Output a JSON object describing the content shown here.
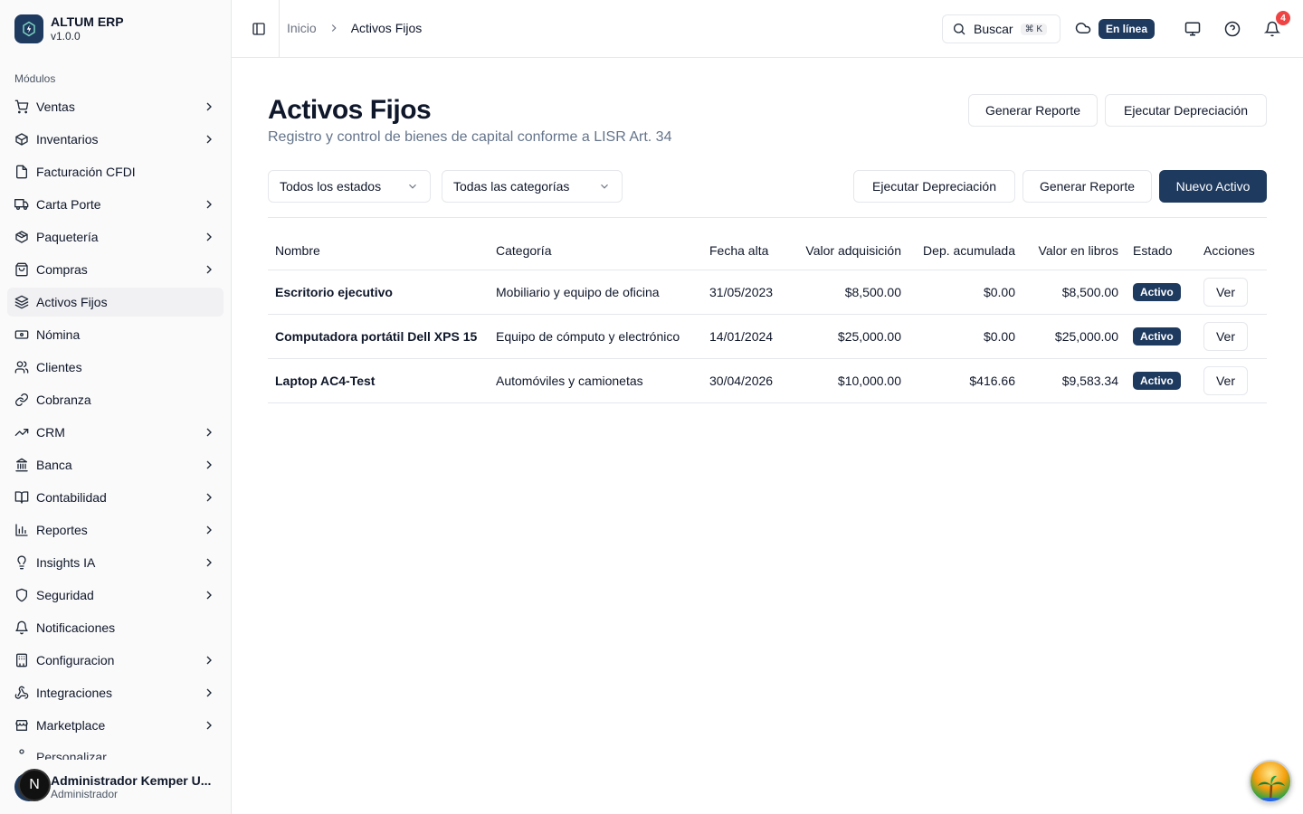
{
  "brand": {
    "name": "ALTUM ERP",
    "version": "v1.0.0"
  },
  "sidebar": {
    "section_label": "Módulos",
    "items": [
      {
        "label": "Ventas",
        "icon": "cart-icon",
        "chevron": true
      },
      {
        "label": "Inventarios",
        "icon": "package-icon",
        "chevron": true
      },
      {
        "label": "Facturación CFDI",
        "icon": "file-icon",
        "chevron": false
      },
      {
        "label": "Carta Porte",
        "icon": "truck-icon",
        "chevron": true
      },
      {
        "label": "Paquetería",
        "icon": "box-icon",
        "chevron": true
      },
      {
        "label": "Compras",
        "icon": "shopping-bag-icon",
        "chevron": true
      },
      {
        "label": "Activos Fijos",
        "icon": "layers-icon",
        "chevron": false,
        "active": true
      },
      {
        "label": "Nómina",
        "icon": "banknote-icon",
        "chevron": false
      },
      {
        "label": "Clientes",
        "icon": "users-icon",
        "chevron": false
      },
      {
        "label": "Cobranza",
        "icon": "link-icon",
        "chevron": false
      },
      {
        "label": "CRM",
        "icon": "trending-up-icon",
        "chevron": true
      },
      {
        "label": "Banca",
        "icon": "bank-icon",
        "chevron": true
      },
      {
        "label": "Contabilidad",
        "icon": "book-icon",
        "chevron": true
      },
      {
        "label": "Reportes",
        "icon": "bar-chart-icon",
        "chevron": true
      },
      {
        "label": "Insights IA",
        "icon": "lightbulb-icon",
        "chevron": true
      },
      {
        "label": "Seguridad",
        "icon": "shield-icon",
        "chevron": true
      },
      {
        "label": "Notificaciones",
        "icon": "bell-icon",
        "chevron": false
      },
      {
        "label": "Configuracion",
        "icon": "building-icon",
        "chevron": true
      },
      {
        "label": "Integraciones",
        "icon": "webhook-icon",
        "chevron": true
      },
      {
        "label": "Marketplace",
        "icon": "store-icon",
        "chevron": true
      }
    ],
    "partial_item_label": "Personalizar"
  },
  "user": {
    "initial": "N",
    "name": "Administrador Kemper U...",
    "role": "Administrador"
  },
  "header": {
    "breadcrumb": {
      "home": "Inicio",
      "current": "Activos Fijos"
    },
    "search_label": "Buscar",
    "search_shortcut": "⌘ K",
    "status": "En línea",
    "notification_count": "4"
  },
  "page": {
    "title": "Activos Fijos",
    "subtitle": "Registro y control de bienes de capital conforme a LISR Art. 34",
    "top_actions": {
      "report": "Generar Reporte",
      "depreciation": "Ejecutar Depreciación"
    },
    "filters": {
      "status": "Todos los estados",
      "category": "Todas las categorías"
    },
    "toolbar": {
      "depreciation": "Ejecutar Depreciación",
      "report": "Generar Reporte",
      "new": "Nuevo Activo"
    }
  },
  "table": {
    "columns": [
      "Nombre",
      "Categoría",
      "Fecha alta",
      "Valor adquisición",
      "Dep. acumulada",
      "Valor en libros",
      "Estado",
      "Acciones"
    ],
    "rows": [
      {
        "name": "Escritorio ejecutivo",
        "category": "Mobiliario y equipo de oficina",
        "date": "31/05/2023",
        "acquisition": "$8,500.00",
        "depreciation": "$0.00",
        "book_value": "$8,500.00",
        "status": "Activo",
        "action": "Ver"
      },
      {
        "name": "Computadora portátil Dell XPS 15",
        "category": "Equipo de cómputo y electrónico",
        "date": "14/01/2024",
        "acquisition": "$25,000.00",
        "depreciation": "$0.00",
        "book_value": "$25,000.00",
        "status": "Activo",
        "action": "Ver"
      },
      {
        "name": "Laptop AC4-Test",
        "category": "Automóviles y camionetas",
        "date": "30/04/2026",
        "acquisition": "$10,000.00",
        "depreciation": "$416.66",
        "book_value": "$9,583.34",
        "status": "Activo",
        "action": "Ver"
      }
    ]
  },
  "colors": {
    "primary": "#1e3a5f",
    "notification": "#ef4444",
    "muted_text": "#64748b"
  }
}
